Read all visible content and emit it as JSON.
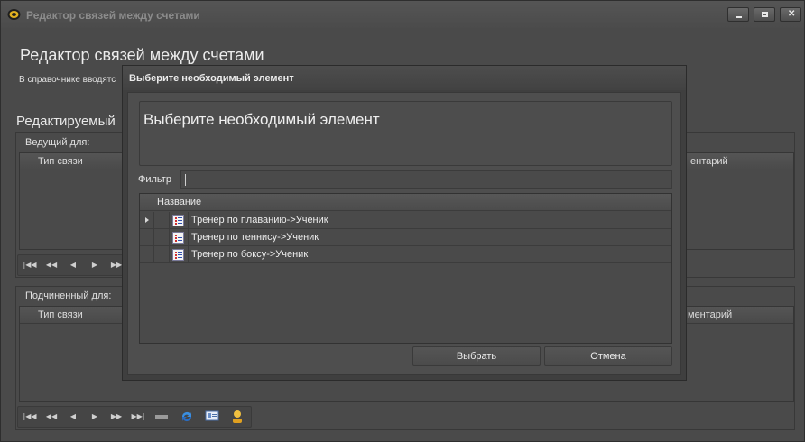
{
  "window": {
    "title": "Редактор связей между счетами"
  },
  "main": {
    "page_title": "Редактор связей между счетами",
    "description": "В справочнике вводятс",
    "section_title": "Редактируемый",
    "leading": {
      "label": "Ведущий для:",
      "col_type": "Тип связи",
      "col_comment": "ентарий"
    },
    "subordinate": {
      "label": "Подчиненный для:",
      "col_type": "Тип связи",
      "col_comment": "ментарий"
    }
  },
  "dialog": {
    "title": "Выберите необходимый элемент",
    "heading": "Выберите необходимый элемент",
    "filter_label": "Фильтр",
    "filter_value": "",
    "list_header": "Название",
    "items": [
      {
        "name": "Тренер по плаванию->Ученик",
        "current": true
      },
      {
        "name": "Тренер по теннису->Ученик",
        "current": false
      },
      {
        "name": "Тренер по боксу->Ученик",
        "current": false
      }
    ],
    "ok_label": "Выбрать",
    "cancel_label": "Отмена"
  }
}
